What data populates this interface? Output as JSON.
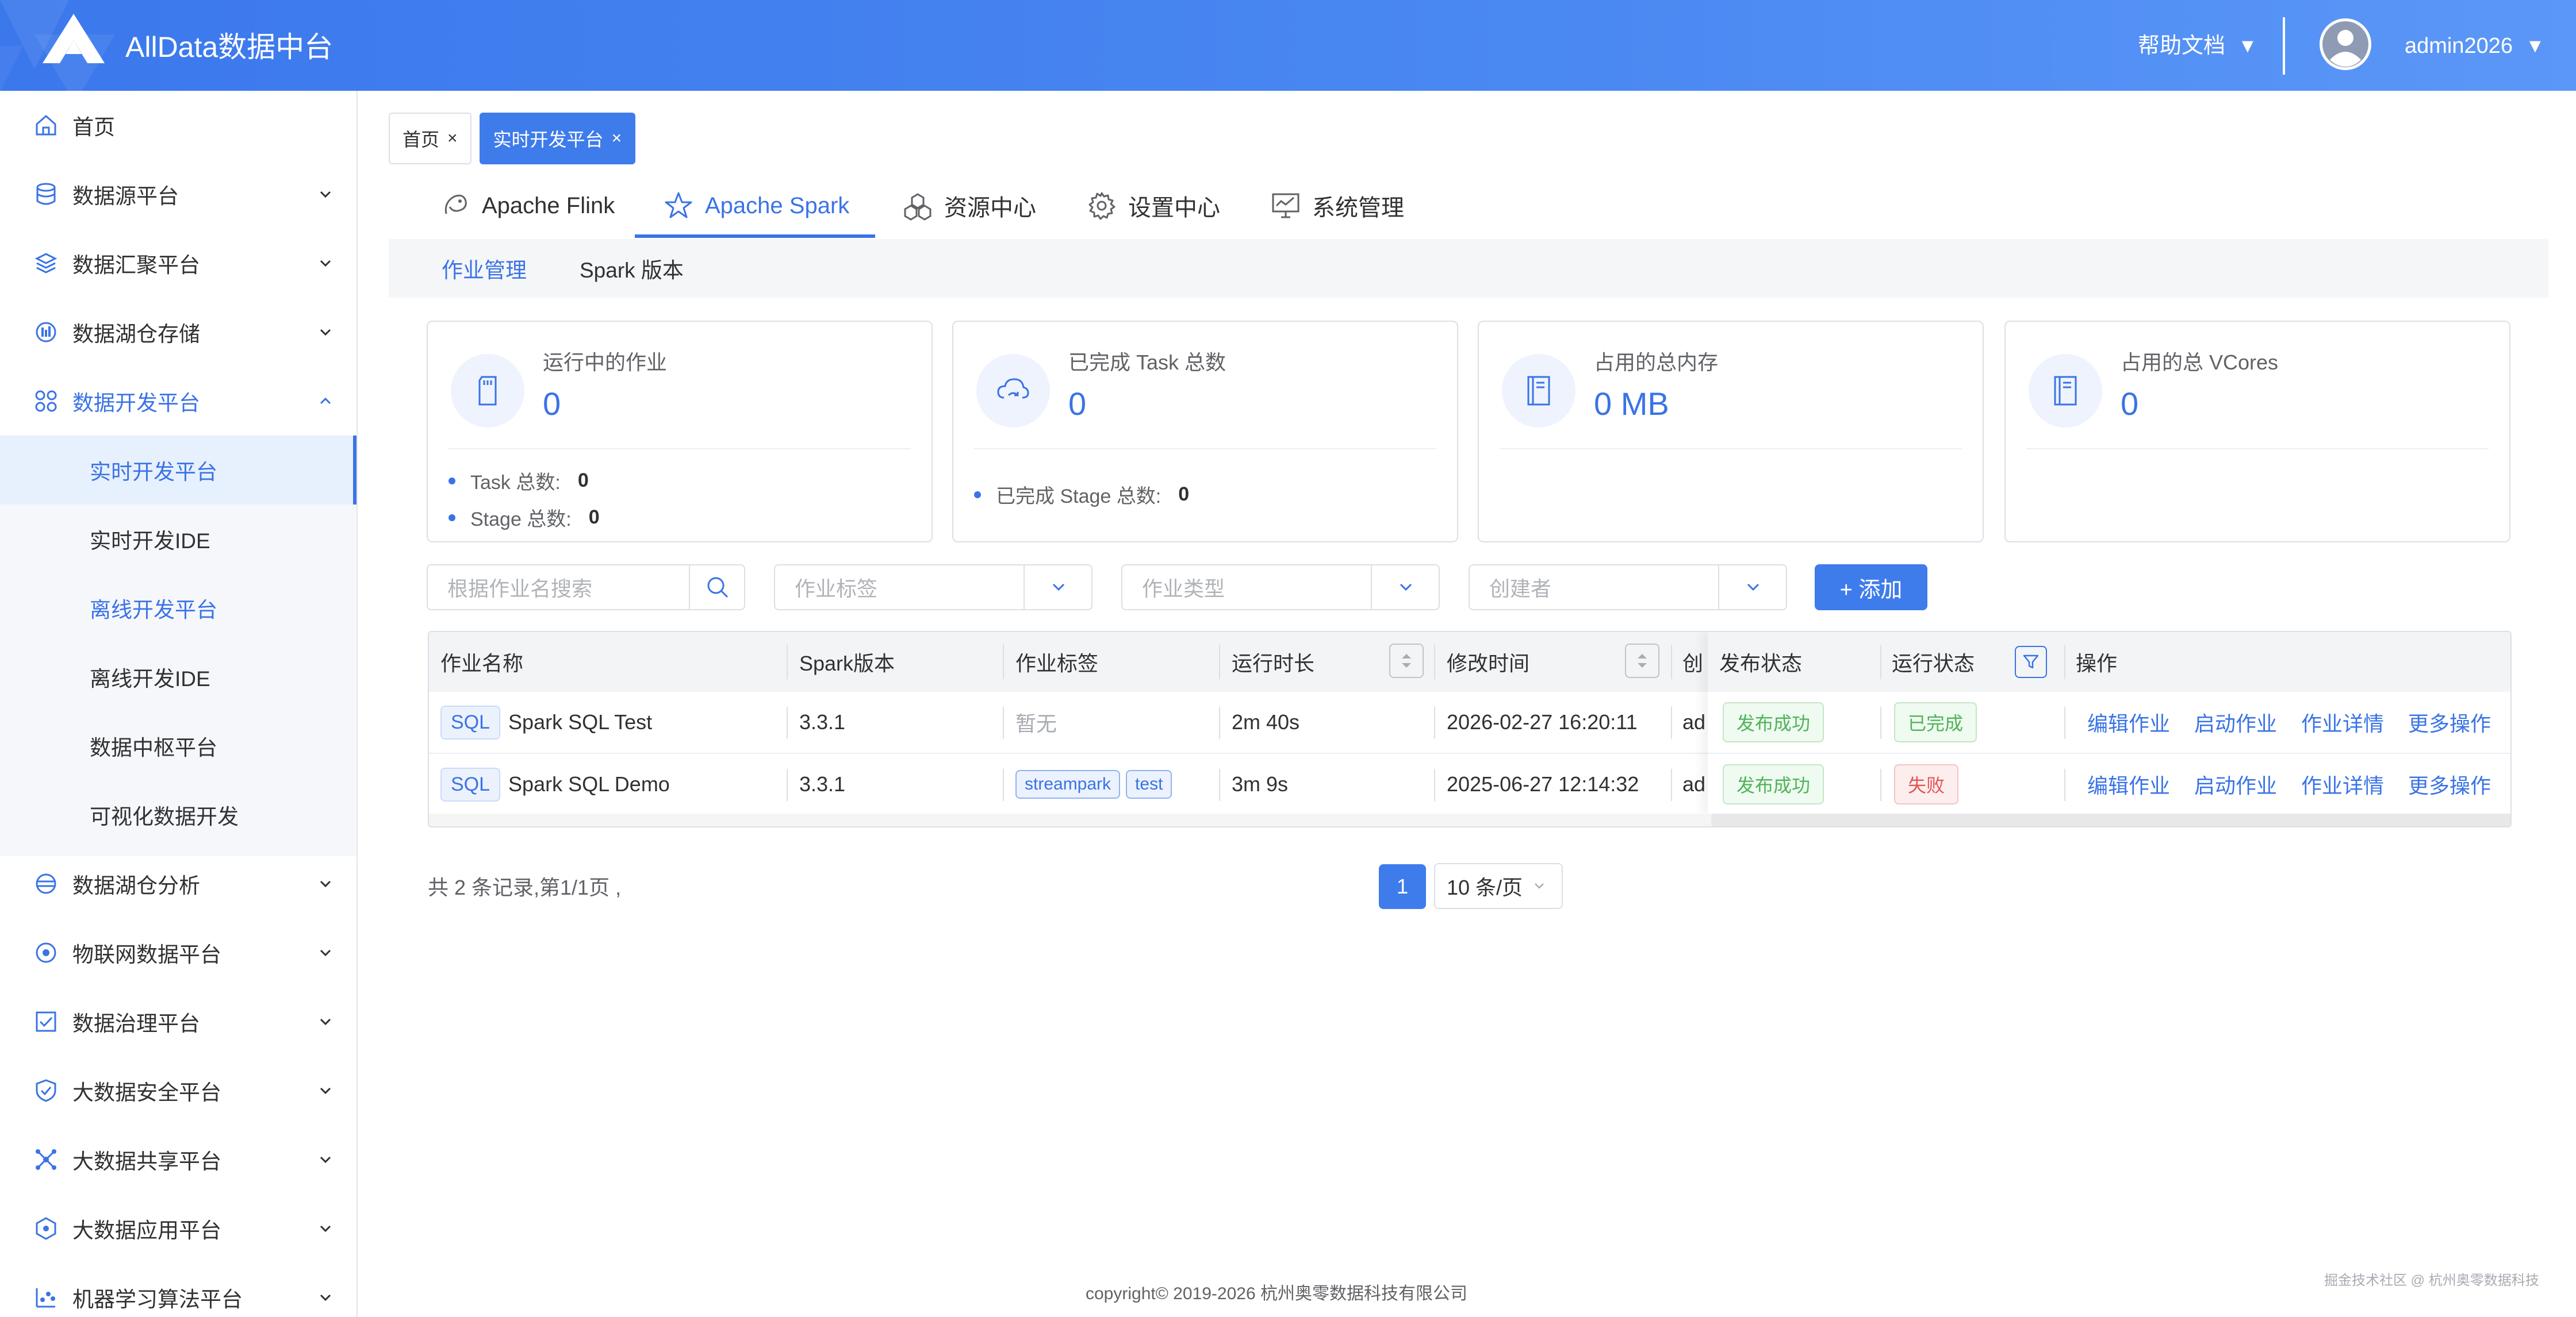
{
  "app": {
    "title": "AllData数据中台"
  },
  "header": {
    "help_label": "帮助文档",
    "user_name": "admin2026",
    "dropdown_glyph": "▼"
  },
  "sidebar": {
    "items": [
      {
        "label": "首页",
        "icon": "home-icon"
      },
      {
        "label": "数据源平台",
        "icon": "database-icon"
      },
      {
        "label": "数据汇聚平台",
        "icon": "layers-icon"
      },
      {
        "label": "数据湖仓存储",
        "icon": "storage-icon"
      },
      {
        "label": "数据开发平台",
        "icon": "grid-icon",
        "expanded": true
      },
      {
        "label": "数据湖仓分析",
        "icon": "analysis-icon"
      },
      {
        "label": "物联网数据平台",
        "icon": "iot-icon"
      },
      {
        "label": "数据治理平台",
        "icon": "checklist-icon"
      },
      {
        "label": "大数据安全平台",
        "icon": "shield-icon"
      },
      {
        "label": "大数据共享平台",
        "icon": "share-icon"
      },
      {
        "label": "大数据应用平台",
        "icon": "app-icon"
      },
      {
        "label": "机器学习算法平台",
        "icon": "ml-icon"
      }
    ],
    "sub_items": [
      {
        "label": "实时开发平台",
        "active": true
      },
      {
        "label": "实时开发IDE"
      },
      {
        "label": "离线开发平台",
        "highlight": true
      },
      {
        "label": "离线开发IDE"
      },
      {
        "label": "数据中枢平台"
      },
      {
        "label": "可视化数据开发"
      }
    ]
  },
  "tags": [
    {
      "label": "首页",
      "close": "×"
    },
    {
      "label": "实时开发平台",
      "close": "×",
      "active": true
    }
  ],
  "tabs": [
    {
      "label": "Apache Flink",
      "icon": "flink-icon"
    },
    {
      "label": "Apache Spark",
      "icon": "spark-star-icon",
      "active": true
    },
    {
      "label": "资源中心",
      "icon": "resource-icon"
    },
    {
      "label": "设置中心",
      "icon": "gear-icon"
    },
    {
      "label": "系统管理",
      "icon": "monitor-icon"
    }
  ],
  "subtabs": [
    {
      "label": "作业管理",
      "active": true
    },
    {
      "label": "Spark 版本"
    }
  ],
  "cards": [
    {
      "title": "运行中的作业",
      "value": "0",
      "icon": "sd-card-icon",
      "stats": [
        {
          "label": "Task 总数:",
          "value": "0"
        },
        {
          "label": "Stage 总数:",
          "value": "0"
        }
      ]
    },
    {
      "title": "已完成 Task 总数",
      "value": "0",
      "icon": "cloud-sync-icon",
      "stats": [
        {
          "label": "已完成 Stage 总数:",
          "value": "0"
        }
      ]
    },
    {
      "title": "占用的总内存",
      "value": "0 MB",
      "icon": "book-icon",
      "stats": []
    },
    {
      "title": "占用的总 VCores",
      "value": "0",
      "icon": "book-icon",
      "stats": []
    }
  ],
  "filters": {
    "search_placeholder": "根据作业名搜索",
    "tag_placeholder": "作业标签",
    "type_placeholder": "作业类型",
    "creator_placeholder": "创建者",
    "add_label": "+ 添加"
  },
  "table": {
    "columns": [
      "作业名称",
      "Spark版本",
      "作业标签",
      "运行时长",
      "修改时间",
      "创",
      "发布状态",
      "运行状态",
      "操作"
    ],
    "rows": [
      {
        "type": "SQL",
        "name": "Spark SQL Test",
        "version": "3.3.1",
        "tags": [],
        "tags_empty": "暂无",
        "duration": "2m 40s",
        "modified": "2026-02-27 16:20:11",
        "creator": "ad",
        "publish": "发布成功",
        "run": "已完成",
        "run_color": "green"
      },
      {
        "type": "SQL",
        "name": "Spark SQL Demo",
        "version": "3.3.1",
        "tags": [
          "streampark",
          "test"
        ],
        "tags_empty": "",
        "duration": "3m 9s",
        "modified": "2025-06-27 12:14:32",
        "creator": "ad",
        "publish": "发布成功",
        "run": "失败",
        "run_color": "red"
      }
    ],
    "actions": [
      "编辑作业",
      "启动作业",
      "作业详情",
      "更多操作"
    ]
  },
  "pagination": {
    "total_text": "共 2 条记录,第1/1页 ,",
    "current_page": "1",
    "page_size": "10 条/页"
  },
  "footer": {
    "copyright": "copyright© 2019-2026 杭州奥零数据科技有限公司",
    "watermark": "掘金技术社区 @ 杭州奥零数据科技"
  },
  "colors": {
    "primary": "#3a73e6",
    "header": "#4a88f2",
    "success": "#50b35a",
    "danger": "#e55353"
  }
}
